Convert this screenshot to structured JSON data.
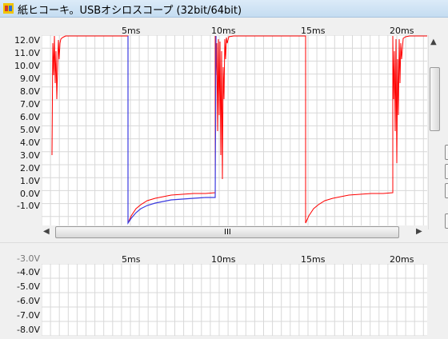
{
  "window": {
    "title": "紙ヒコーキ。USBオシロスコープ (32bit/64bit)"
  },
  "plot1": {
    "x_ticks": [
      "5ms",
      "10ms",
      "15ms",
      "20ms"
    ],
    "y_ticks": [
      "12.0V",
      "11.0V",
      "10.0V",
      "9.0V",
      "8.0V",
      "7.0V",
      "6.0V",
      "5.0V",
      "4.0V",
      "3.0V",
      "2.0V",
      "1.0V",
      "0.0V",
      "-1.0V"
    ],
    "traces": [
      {
        "name": "",
        "color": "#ff0000"
      },
      {
        "name": "",
        "color": "#3a3adf"
      }
    ]
  },
  "plot2": {
    "x_ticks": [
      "5ms",
      "10ms",
      "15ms",
      "20ms"
    ],
    "y_ticks": [
      "-3.0V",
      "-4.0V",
      "-5.0V",
      "-6.0V",
      "-7.0V",
      "-8.0V"
    ]
  },
  "scrollbar": {
    "grip": "III"
  },
  "icons": {
    "left_arrow": "triangle-left",
    "right_arrow": "triangle-right"
  }
}
